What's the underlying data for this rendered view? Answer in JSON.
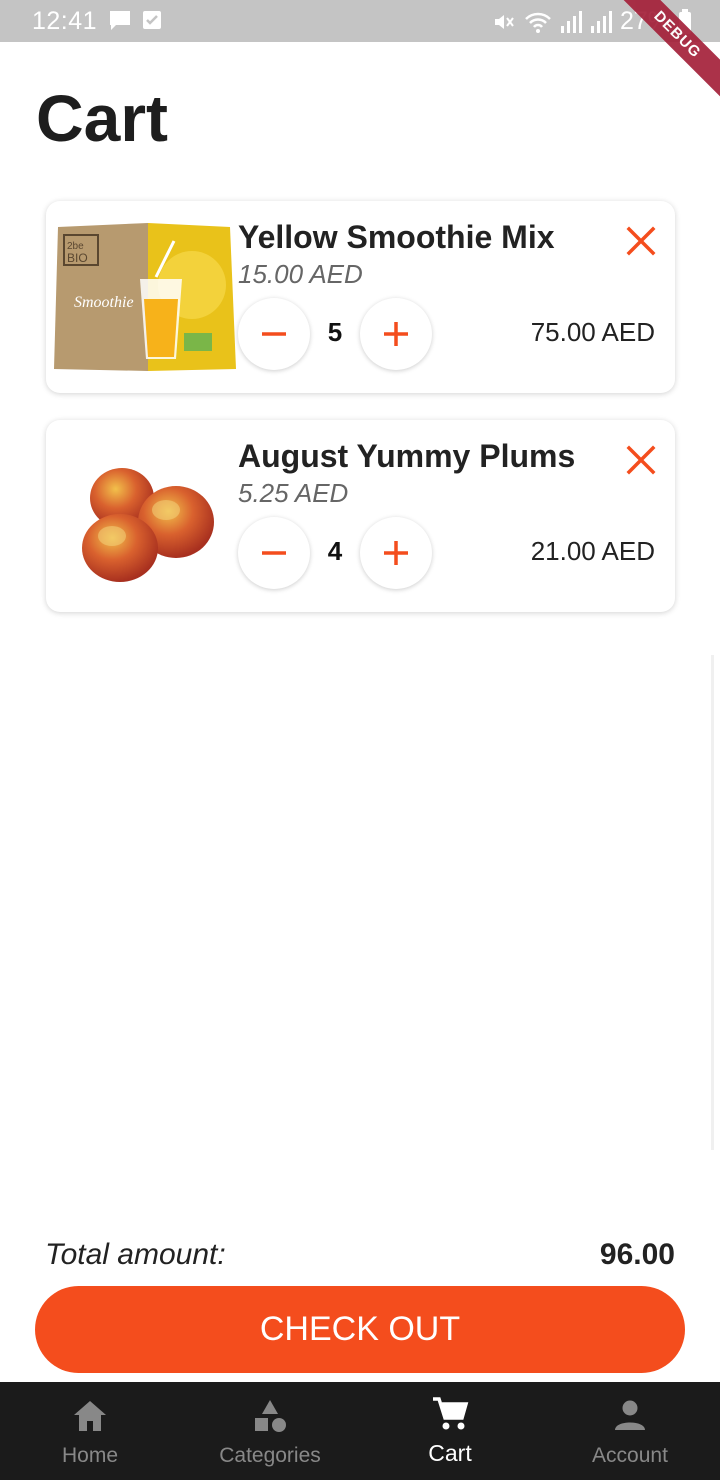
{
  "status_bar": {
    "time": "12:41",
    "battery": "27%",
    "icons": [
      "chat-icon",
      "check-box-icon",
      "mute-icon",
      "wifi-icon",
      "signal-icon",
      "signal-icon",
      "battery-icon"
    ],
    "debug_label": "DEBUG"
  },
  "page": {
    "title": "Cart"
  },
  "cart": {
    "items": [
      {
        "name": "Yellow Smoothie Mix",
        "unit_price": "15.00 AED",
        "quantity": "5",
        "line_total": "75.00 AED",
        "image": "smoothie-pack-image"
      },
      {
        "name": "August Yummy Plums",
        "unit_price": "5.25 AED",
        "quantity": "4",
        "line_total": "21.00 AED",
        "image": "plums-image"
      }
    ]
  },
  "summary": {
    "total_label": "Total amount:",
    "total_value": "96.00",
    "checkout_label": "CHECK OUT"
  },
  "nav": {
    "items": [
      {
        "label": "Home",
        "icon": "home-icon"
      },
      {
        "label": "Categories",
        "icon": "shapes-icon"
      },
      {
        "label": "Cart",
        "icon": "cart-icon"
      },
      {
        "label": "Account",
        "icon": "person-icon"
      }
    ],
    "active": "Cart"
  },
  "colors": {
    "accent": "#f44d1d",
    "nav_background": "#1b1b1b",
    "status_bar": "#c4c4c4",
    "debug_ribbon": "#a4213a"
  }
}
